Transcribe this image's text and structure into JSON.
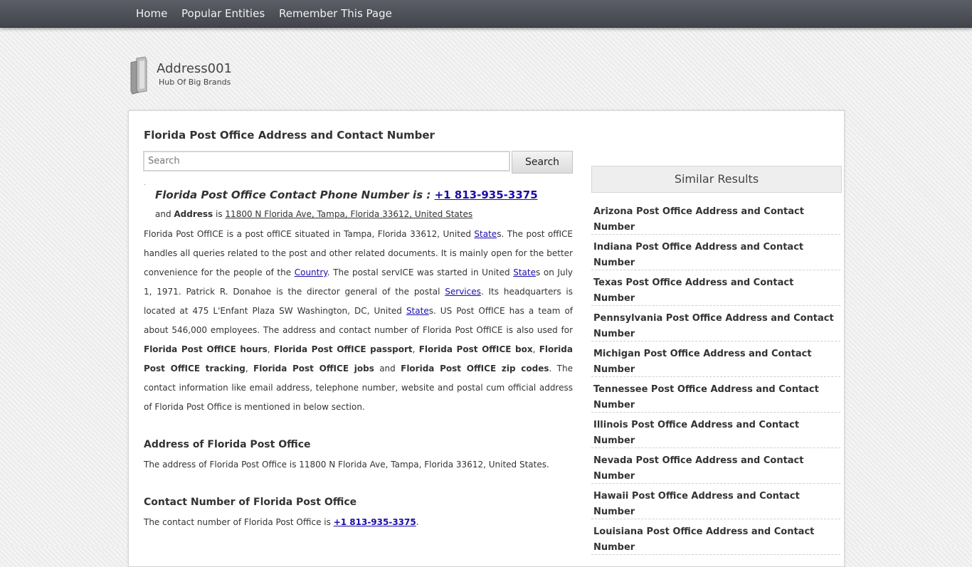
{
  "nav": {
    "home": "Home",
    "popular": "Popular Entities",
    "remember": "Remember This Page"
  },
  "site": {
    "title": "Address001",
    "tagline": "Hub Of Big Brands"
  },
  "main": {
    "page_title": "Florida Post Office Address and Contact Number",
    "search_placeholder": "Search",
    "search_button": "Search",
    "dot": ".",
    "phone_label": "Florida Post Office Contact Phone Number is : ",
    "phone": "+1 813-935-3375",
    "addr_prefix": "and ",
    "addr_label": "Address",
    "addr_is": " is ",
    "address": "11800 N Florida Ave, Tampa, Florida 33612, United States",
    "description": {
      "t1": "Florida Post OffICE is a post offICE situated in Tampa, Florida 33612, United ",
      "l1": "State",
      "t2": "s. The post offICE handles all queries related to the post and other related documents. It is mainly open for the better convenience for the people of the ",
      "l2": "Country",
      "t3": ". The postal servICE was started in United ",
      "l3": "State",
      "t4": "s on July 1, 1971. Patrick R. Donahoe is the director general of the postal ",
      "l4": "Services",
      "t5": ". Its headquarters is located at 475 L'Enfant Plaza SW Washington, DC, United ",
      "l5": "State",
      "t6": "s. US Post OffICE has a team of about 546,000 employees. The address and contact number of Florida Post OffICE is also used for ",
      "b1": "Florida Post OffICE hours",
      "s1": ", ",
      "b2": "Florida Post OffICE passport",
      "s2": ", ",
      "b3": "Florida Post OffICE box",
      "s3": ", ",
      "b4": "Florida Post OffICE tracking",
      "s4": ", ",
      "b5": "Florida Post OffICE jobs",
      "s5": " and ",
      "b6": "Florida Post OffICE zip codes",
      "t7": ". The contact information like email address, telephone number, website and postal cum official address of Florida Post Office is mentioned in below section."
    },
    "address_section": {
      "title": "Address of Florida Post Office",
      "text": "The address of Florida Post Office is 11800 N Florida Ave, Tampa, Florida 33612, United States."
    },
    "contact_section": {
      "title": "Contact Number of Florida Post Office",
      "text_prefix": "The contact number of Florida Post Office is ",
      "phone": "+1 813-935-3375",
      "text_suffix": "."
    }
  },
  "similar": {
    "title": "Similar Results",
    "items": [
      "Arizona Post Office Address and Contact Number",
      "Indiana Post Office Address and Contact Number",
      "Texas Post Office Address and Contact Number",
      "Pennsylvania Post Office Address and Contact Number",
      "Michigan Post Office Address and Contact Number",
      "Tennessee Post Office Address and Contact Number",
      "Illinois Post Office Address and Contact Number",
      "Nevada Post Office Address and Contact Number",
      "Hawaii Post Office Address and Contact Number",
      "Louisiana Post Office Address and Contact Number"
    ]
  },
  "colors": {
    "nav_bg": "#4a4d54",
    "link": "#1a0dab",
    "text": "#333333"
  }
}
